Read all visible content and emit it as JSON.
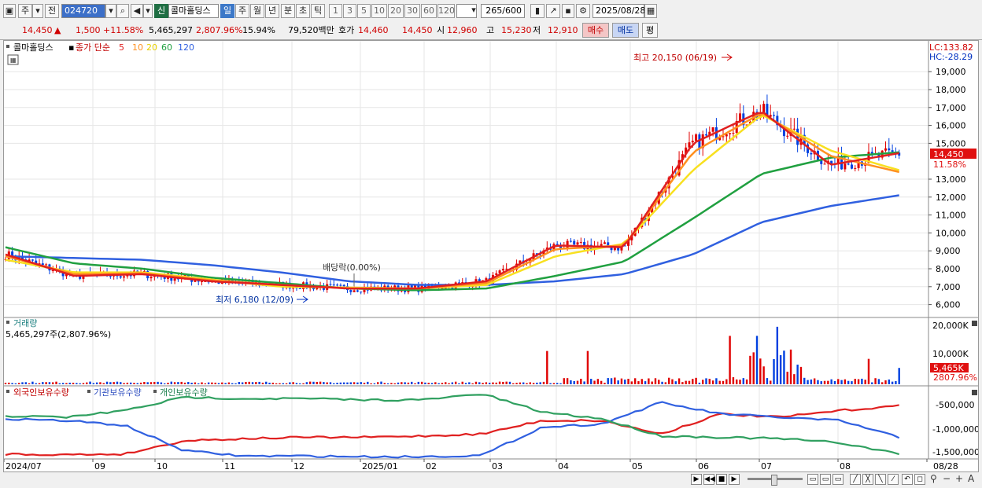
{
  "toolbar": {
    "market": "주",
    "prev": "전",
    "code": "024720",
    "new_badge": "신",
    "stock_name": "콜마홀딩스",
    "periods": [
      "일",
      "주",
      "월",
      "년",
      "분",
      "초",
      "틱"
    ],
    "intervals": [
      "1",
      "3",
      "5",
      "10",
      "20",
      "30",
      "60",
      "120"
    ],
    "count": "265",
    "count_total": "/600",
    "date": "2025/08/28"
  },
  "quote": {
    "price": "14,450",
    "change": "1,500",
    "change_pct": "+11.58%",
    "volume": "5,465,297",
    "volume_pct": "2,807.96%",
    "turnover": "15.94%",
    "amount": "79,520백만",
    "ask_label": "호가",
    "ask": "14,460",
    "bid": "14,450",
    "open_label": "시",
    "open": "12,960",
    "high_label": "고",
    "high": "15,230",
    "low_label": "저",
    "low": "12,910",
    "buy_btn": "매수",
    "sell_btn": "매도",
    "eval_btn": "평"
  },
  "price_panel": {
    "legend_name": "콜마홀딩스",
    "legend_ma": "종가 단순",
    "ma_periods": [
      "5",
      "10",
      "20",
      "60",
      "120"
    ],
    "lc": "LC:133.82",
    "hc": "HC:-28.29",
    "high_note": "최고 20,150 (06/19)",
    "low_note": "최저 6,180 (12/09)",
    "dividend_note": "배당락(0.00%)",
    "current_price_tag": "14,450",
    "current_pct_tag": "11.58%",
    "y_ticks": [
      "19,000",
      "18,000",
      "17,000",
      "16,000",
      "15,000",
      "13,000",
      "12,000",
      "11,000",
      "10,000",
      "9,000",
      "8,000",
      "7,000",
      "6,000"
    ]
  },
  "volume_panel": {
    "title": "거래량",
    "value": "5,465,297주(2,807.96%)",
    "y_ticks": [
      "20,000K",
      "10,000K"
    ],
    "tag_value": "5,465K",
    "tag_pct": "2807.96%"
  },
  "holder_panel": {
    "legend": [
      "외국인보유수량",
      "기관보유수량",
      "개인보유수량"
    ],
    "y_ticks": [
      "-500,000",
      "-1,000,000",
      "-1,500,000"
    ]
  },
  "x_axis": [
    "2024/07",
    "09",
    "10",
    "11",
    "12",
    "2025/01",
    "02",
    "03",
    "04",
    "05",
    "06",
    "07",
    "08",
    "08/28"
  ],
  "colors": {
    "up": "#e00000",
    "down": "#0040e0",
    "ma5": "#e02020",
    "ma10": "#ff9020",
    "ma20": "#f8e020",
    "ma60": "#20a040",
    "ma120": "#3060e0",
    "foreign": "#e02020",
    "institution": "#3060e0",
    "individual": "#30a060"
  },
  "chart_data": {
    "type": "line",
    "x": [
      "2024/07",
      "09",
      "10",
      "11",
      "12",
      "2025/01",
      "02",
      "03",
      "04",
      "05",
      "06",
      "07",
      "08",
      "08/28"
    ],
    "series": [
      {
        "name": "5",
        "values": [
          8800,
          7600,
          7700,
          7300,
          7100,
          6900,
          6900,
          7300,
          9300,
          9200,
          15000,
          16800,
          13800,
          14450
        ]
      },
      {
        "name": "10",
        "values": [
          8700,
          7700,
          7750,
          7350,
          7100,
          6900,
          6900,
          7200,
          9100,
          9300,
          14500,
          16700,
          14300,
          13400
        ]
      },
      {
        "name": "20",
        "values": [
          8500,
          7800,
          7800,
          7400,
          7000,
          6950,
          6900,
          7100,
          8700,
          9400,
          13500,
          16600,
          14600,
          13500
        ]
      },
      {
        "name": "60",
        "values": [
          9200,
          8300,
          8000,
          7500,
          7200,
          6900,
          6800,
          6900,
          7600,
          8400,
          10800,
          13300,
          14200,
          14500
        ]
      },
      {
        "name": "120",
        "values": [
          8700,
          8600,
          8500,
          8200,
          7800,
          7300,
          7100,
          7100,
          7300,
          7700,
          8800,
          10600,
          11500,
          12100
        ]
      }
    ],
    "ylim": [
      5500,
      20500
    ]
  }
}
